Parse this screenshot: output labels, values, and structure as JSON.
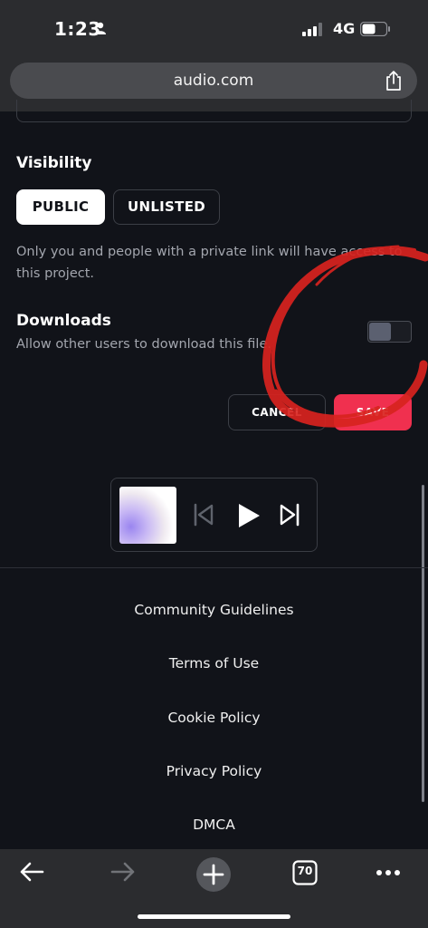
{
  "status_bar": {
    "time": "1:23",
    "network": "4G"
  },
  "browser": {
    "url": "audio.com",
    "tab_count": "70"
  },
  "visibility": {
    "title": "Visibility",
    "options": [
      "PUBLIC",
      "UNLISTED"
    ],
    "selected": "PUBLIC",
    "description": "Only you and people with a private link will have access to this project."
  },
  "downloads": {
    "title": "Downloads",
    "description": "Allow other users to download this file.",
    "enabled": false
  },
  "actions": {
    "cancel_label": "CANCEL",
    "save_label": "SAVE"
  },
  "footer": {
    "links": [
      "Community Guidelines",
      "Terms of Use",
      "Cookie Policy",
      "Privacy Policy",
      "DMCA"
    ]
  },
  "colors": {
    "background": "#111319",
    "browser_chrome": "#2b2c2f",
    "accent_save": "#f0304f",
    "annotation_red": "#d8231f"
  }
}
